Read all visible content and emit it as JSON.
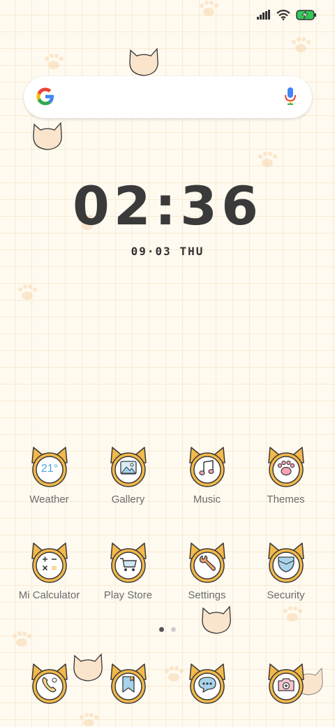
{
  "clock": {
    "time": "02:36",
    "date": "09·03 THU"
  },
  "apps": [
    {
      "name": "Weather",
      "glyph_text": "21°"
    },
    {
      "name": "Gallery"
    },
    {
      "name": "Music"
    },
    {
      "name": "Themes"
    },
    {
      "name": "Mi Calculator"
    },
    {
      "name": "Play Store"
    },
    {
      "name": "Settings"
    },
    {
      "name": "Security"
    }
  ],
  "dock": [
    "phone-icon",
    "bookmark-icon",
    "messages-icon",
    "camera-icon"
  ],
  "pager": {
    "pages": 2,
    "current": 1
  },
  "colors": {
    "background": "#fffaf0",
    "grid": "#f6ead2",
    "cat_ear": "#f3b94a",
    "icon_outline": "#3a3a3a",
    "label": "#6b6b6b"
  }
}
